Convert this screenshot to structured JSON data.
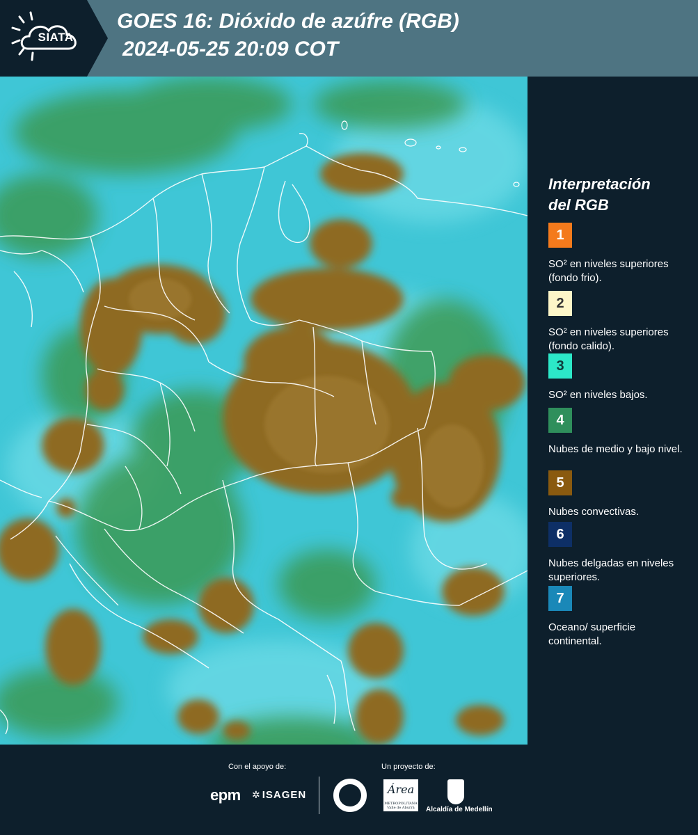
{
  "header": {
    "logo_text": "SIATA",
    "title_line1": "GOES 16: Dióxido de azúfre (RGB)",
    "title_line2": "2024-05-25 20:09 COT"
  },
  "legend": {
    "title_line1": "Interpretación",
    "title_line2": "del RGB",
    "items": [
      {
        "number": "1",
        "label": "SO² en niveles superiores (fondo frio).",
        "color": "#f47a1c",
        "text_color": "#ffffff"
      },
      {
        "number": "2",
        "label": "SO² en niveles superiores (fondo calido).",
        "color": "#fdf6c8",
        "text_color": "#333333"
      },
      {
        "number": "3",
        "label": "SO² en niveles bajos.",
        "color": "#2ce8c8",
        "text_color": "#0d3b3b"
      },
      {
        "number": "4",
        "label": "Nubes de medio y bajo nivel.",
        "color": "#2f8f5c",
        "text_color": "#ffffff"
      },
      {
        "number": "5",
        "label": "Nubes convectivas.",
        "color": "#8a5a0f",
        "text_color": "#ffffff"
      },
      {
        "number": "6",
        "label": "Nubes delgadas en niveles superiores.",
        "color": "#0d2f66",
        "text_color": "#ffffff"
      },
      {
        "number": "7",
        "label": "Oceano/ superficie continental.",
        "color": "#1a88b8",
        "text_color": "#ffffff"
      }
    ]
  },
  "footer": {
    "support_label": "Con el apoyo de:",
    "project_label": "Un proyecto de:",
    "epm_logo": "epm",
    "isagen_logo": "ISAGEN",
    "area_logo": "Área",
    "area_sub": "METROPOLITANA Valle de Aburrá",
    "alcaldia_logo": "Alcaldía de Medellín"
  },
  "map": {
    "background_color": "#3fc6d6",
    "cloud_convective_color": "#8e6a22",
    "cloud_mid_color": "#3a9a55"
  }
}
